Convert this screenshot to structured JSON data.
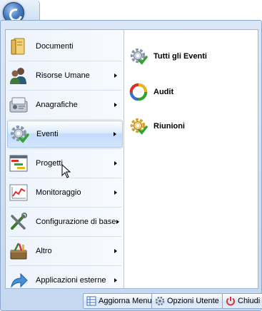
{
  "app": {
    "orb_icon": "app-orb-icon"
  },
  "menu": {
    "items": [
      {
        "label": "Documenti",
        "icon": "folder-documents-icon",
        "has_submenu": false,
        "active": false
      },
      {
        "label": "Risorse Umane",
        "icon": "people-icon",
        "has_submenu": true,
        "active": false
      },
      {
        "label": "Anagrafiche",
        "icon": "contacts-icon",
        "has_submenu": true,
        "active": false
      },
      {
        "label": "Eventi",
        "icon": "gear-check-icon",
        "has_submenu": true,
        "active": true
      },
      {
        "label": "Progetti",
        "icon": "gantt-chart-icon",
        "has_submenu": true,
        "active": false
      },
      {
        "label": "Monitoraggio",
        "icon": "line-chart-icon",
        "has_submenu": true,
        "active": false
      },
      {
        "label": "Configurazione di base",
        "icon": "tools-icon",
        "has_submenu": true,
        "active": false
      },
      {
        "label": "Altro",
        "icon": "toolbox-icon",
        "has_submenu": true,
        "active": false
      },
      {
        "label": "Applicazioni esterne",
        "icon": "share-arrow-icon",
        "has_submenu": true,
        "active": false
      }
    ],
    "submenu": [
      {
        "label": "Tutti gli Eventi",
        "icon": "gear-check-icon"
      },
      {
        "label": "Audit",
        "icon": "audit-cycle-icon"
      },
      {
        "label": "Riunioni",
        "icon": "gear-meeting-icon"
      }
    ]
  },
  "footer": {
    "refresh_label": "Aggiorna Menu",
    "options_label": "Opzioni Utente",
    "close_label": "Chiudi"
  },
  "colors": {
    "accent": "#c1dbfb",
    "frame": "#c5d8ef",
    "close_red": "#d9302b"
  }
}
